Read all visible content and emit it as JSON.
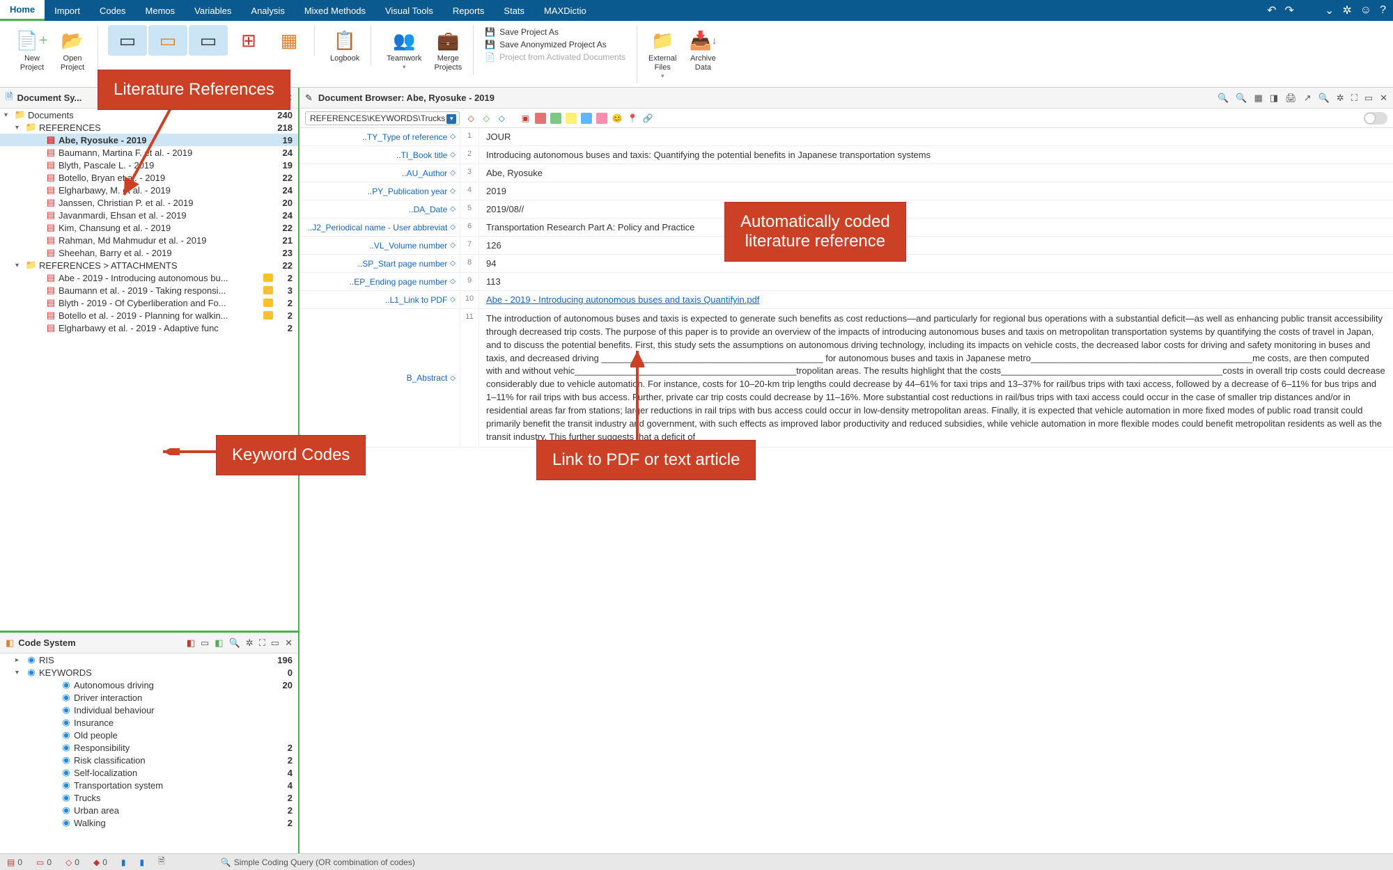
{
  "menu": {
    "tabs": [
      "Home",
      "Import",
      "Codes",
      "Memos",
      "Variables",
      "Analysis",
      "Mixed Methods",
      "Visual Tools",
      "Reports",
      "Stats",
      "MAXDictio"
    ],
    "active": 0
  },
  "toolbar": {
    "new_project": "New\nProject",
    "open_project": "Open\nProject",
    "logbook": "Logbook",
    "teamwork": "Teamwork",
    "merge_projects": "Merge\nProjects",
    "save_as": "Save Project As",
    "save_anon": "Save Anonymized Project As",
    "proj_activated": "Project from Activated Documents",
    "external_files": "External\nFiles",
    "archive_data": "Archive\nData"
  },
  "docsys": {
    "title": "Document Sy...",
    "root": {
      "label": "Documents",
      "count": 240
    },
    "refs_folder": {
      "label": "REFERENCES",
      "count": 218
    },
    "refs": [
      {
        "label": "Abe, Ryosuke - 2019",
        "count": 19,
        "selected": true
      },
      {
        "label": "Baumann, Martina F. et al. - 2019",
        "count": 24
      },
      {
        "label": "Blyth, Pascale L. - 2019",
        "count": 19
      },
      {
        "label": "Botello, Bryan et al. - 2019",
        "count": 22
      },
      {
        "label": "Elgharbawy, M. et al. - 2019",
        "count": 24
      },
      {
        "label": "Janssen, Christian P. et al. - 2019",
        "count": 20
      },
      {
        "label": "Javanmardi, Ehsan et al. - 2019",
        "count": 24
      },
      {
        "label": "Kim, Chansung et al. - 2019",
        "count": 22
      },
      {
        "label": "Rahman, Md Mahmudur et al. - 2019",
        "count": 21
      },
      {
        "label": "Sheehan, Barry et al. - 2019",
        "count": 23
      }
    ],
    "attach_folder": {
      "label": "REFERENCES > ATTACHMENTS",
      "count": 22
    },
    "attachments": [
      {
        "label": "Abe - 2019 - Introducing autonomous bu...",
        "count": 2,
        "memo": true
      },
      {
        "label": "Baumann et al. - 2019 - Taking responsi...",
        "count": 3,
        "memo": true
      },
      {
        "label": "Blyth - 2019 - Of Cyberliberation and Fo...",
        "count": 2,
        "memo": true
      },
      {
        "label": "Botello et al. - 2019 - Planning for walkin...",
        "count": 2,
        "memo": true
      },
      {
        "label": "Elgharbawy et al. - 2019 - Adaptive func",
        "count": 2
      }
    ]
  },
  "codesys": {
    "title": "Code System",
    "ris": {
      "label": "RIS",
      "count": 196
    },
    "kw_folder": {
      "label": "KEYWORDS",
      "count": 0
    },
    "keywords": [
      {
        "label": "Autonomous driving",
        "count": 20
      },
      {
        "label": "Driver interaction",
        "count": ""
      },
      {
        "label": "Individual behaviour",
        "count": ""
      },
      {
        "label": "Insurance",
        "count": ""
      },
      {
        "label": "Old people",
        "count": ""
      },
      {
        "label": "Responsibility",
        "count": 2
      },
      {
        "label": "Risk classification",
        "count": 2
      },
      {
        "label": "Self-localization",
        "count": 4
      },
      {
        "label": "Transportation system",
        "count": 4
      },
      {
        "label": "Trucks",
        "count": 2
      },
      {
        "label": "Urban area",
        "count": 2
      },
      {
        "label": "Walking",
        "count": 2
      }
    ]
  },
  "browser": {
    "title": "Document Browser: Abe, Ryosuke - 2019",
    "crumb": "REFERENCES\\KEYWORDS\\Trucks",
    "fields": [
      {
        "k": "..TY_Type of reference",
        "n": 1,
        "v": "JOUR"
      },
      {
        "k": "..TI_Book title",
        "n": 2,
        "v": "Introducing autonomous buses and taxis: Quantifying the potential benefits in Japanese transportation systems"
      },
      {
        "k": "..AU_Author",
        "n": 3,
        "v": "Abe, Ryosuke"
      },
      {
        "k": "..PY_Publication year",
        "n": 4,
        "v": "2019"
      },
      {
        "k": "..DA_Date",
        "n": 5,
        "v": "2019/08//"
      },
      {
        "k": "..J2_Periodical name - User abbreviat",
        "n": 6,
        "v": "Transportation Research Part A: Policy and Practice"
      },
      {
        "k": "..VL_Volume number",
        "n": 7,
        "v": "126"
      },
      {
        "k": "..SP_Start page number",
        "n": 8,
        "v": "94"
      },
      {
        "k": "..EP_Ending page number",
        "n": 9,
        "v": "113"
      },
      {
        "k": "..L1_Link to PDF",
        "n": 10,
        "v": "Abe - 2019 - Introducing autonomous buses and taxis Quantifyin.pdf",
        "link": true
      }
    ],
    "abstract_label": "B_Abstract",
    "abstract_n": 11,
    "abstract": "The introduction of autonomous buses and taxis is expected to generate such benefits as cost reductions—and particularly for regional bus operations with a substantial deficit—as well as enhancing public transit accessibility through decreased trip costs. The purpose of this paper is to provide an overview of the impacts of introducing autonomous buses and taxis on metropolitan transportation systems by quantifying the costs of travel in Japan, and to discuss the potential benefits. First, this study sets the assumptions on autonomous driving technology, including its impacts on vehicle costs, the decreased labor costs for driving and safety monitoring in buses and taxis, and decreased driving ____________________________________________ for autonomous buses and taxis in Japanese metro____________________________________________me costs, are then computed with and without vehic____________________________________________tropolitan areas. The results highlight that the costs____________________________________________costs in overall trip costs could decrease considerably due to vehicle automation. For instance, costs for 10–20-km trip lengths could decrease by 44–61% for taxi trips and 13–37% for rail/bus trips with taxi access, followed by a decrease of 6–11% for bus trips and 1–11% for rail trips with bus access. Further, private car trip costs could decrease by 11–16%. More substantial cost reductions in rail/bus trips with taxi access could occur in the case of smaller trip distances and/or in residential areas far from stations; larger reductions in rail trips with bus access could occur in low-density metropolitan areas. Finally, it is expected that vehicle automation in more fixed modes of public road transit could primarily benefit the transit industry and government, with such effects as improved labor productivity and reduced subsidies, while vehicle automation in more flexible modes could benefit metropolitan residents as well as the transit industry. This further suggests that a deficit of"
  },
  "callouts": {
    "lit_refs": "Literature References",
    "keyword_codes": "Keyword Codes",
    "auto_coded": "Automatically coded\nliterature reference",
    "link_pdf": "Link to PDF or text article"
  },
  "status": {
    "count1": "0",
    "count2": "0",
    "count3": "0",
    "count4": "0",
    "query": "Simple Coding Query (OR combination of codes)"
  }
}
